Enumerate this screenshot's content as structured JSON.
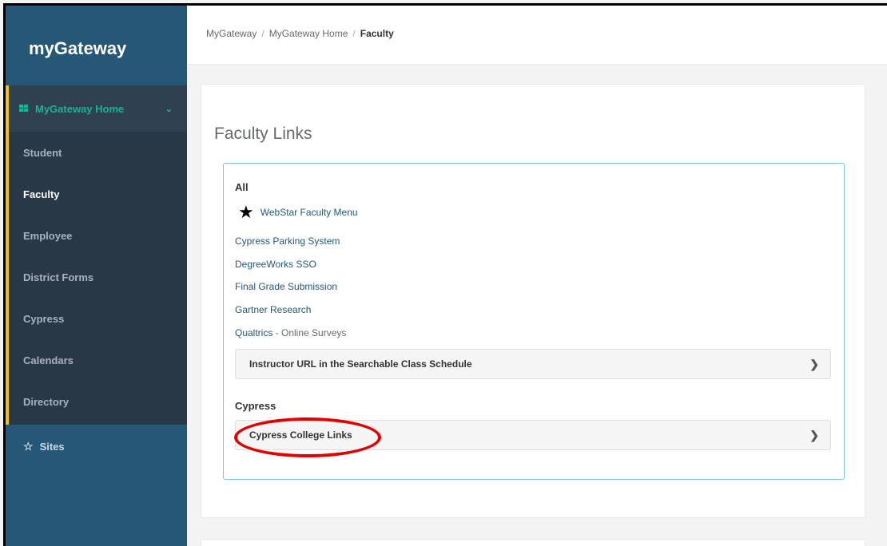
{
  "sidebar": {
    "logo": "myGateway",
    "home_label": "MyGateway Home",
    "items": [
      {
        "label": "Student"
      },
      {
        "label": "Faculty"
      },
      {
        "label": "Employee"
      },
      {
        "label": "District Forms"
      },
      {
        "label": "Cypress"
      },
      {
        "label": "Calendars"
      },
      {
        "label": "Directory"
      }
    ],
    "sites_label": "Sites"
  },
  "breadcrumb": {
    "items": [
      "MyGateway",
      "MyGateway Home"
    ],
    "current": "Faculty",
    "separator": "/"
  },
  "card": {
    "title": "Faculty Links",
    "all_heading": "All",
    "favorite_link": "WebStar Faculty Menu",
    "links": [
      "Cypress Parking System",
      "DegreeWorks SSO",
      "Final Grade Submission",
      "Gartner Research"
    ],
    "qualtrics": {
      "link": "Qualtrics",
      "suffix": " - Online Surveys"
    },
    "instructor_panel": "Instructor URL in the Searchable Class Schedule",
    "cypress_heading": "Cypress",
    "cypress_panel": "Cypress College Links"
  },
  "colors": {
    "accent": "#1ab394",
    "sidebar": "#2f4050",
    "brand_blue": "#255876",
    "active_marker": "#f2c01e",
    "highlight": "#e00000"
  },
  "icons": {
    "home": "grid-icon",
    "home_chevron": "chevron-down-icon",
    "sites": "star-outline-icon",
    "favorite": "star-icon",
    "panel_arrow": "chevron-right-icon"
  }
}
